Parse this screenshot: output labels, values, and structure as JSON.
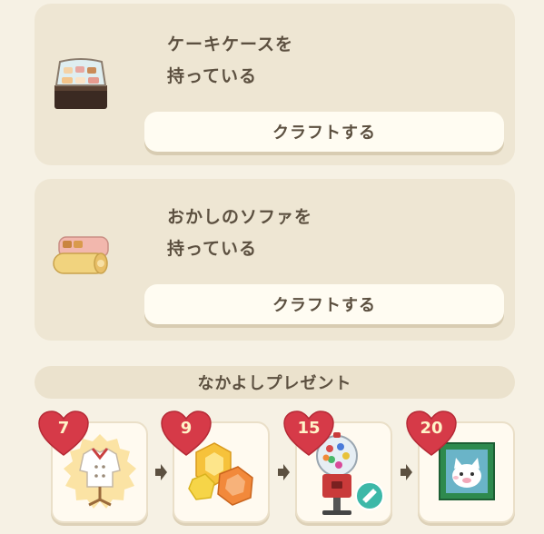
{
  "cards": [
    {
      "title": "ケーキケースを\n持っている",
      "icon": "cake-case-icon",
      "button_label": "クラフトする"
    },
    {
      "title": "おかしのソファを\n持っている",
      "icon": "sweets-sofa-icon",
      "button_label": "クラフトする"
    }
  ],
  "present": {
    "title": "なかよしプレゼント",
    "rewards": [
      {
        "level": "7",
        "icon": "chef-outfit-icon"
      },
      {
        "level": "9",
        "icon": "candy-gems-icon"
      },
      {
        "level": "15",
        "icon": "gumball-machine-icon"
      },
      {
        "level": "20",
        "icon": "cat-portrait-icon"
      }
    ]
  },
  "colors": {
    "background": "#f6f1e4",
    "card": "#eee6d3",
    "button": "#fffcf2",
    "heart": "#d63a48",
    "text": "#5c5040"
  }
}
